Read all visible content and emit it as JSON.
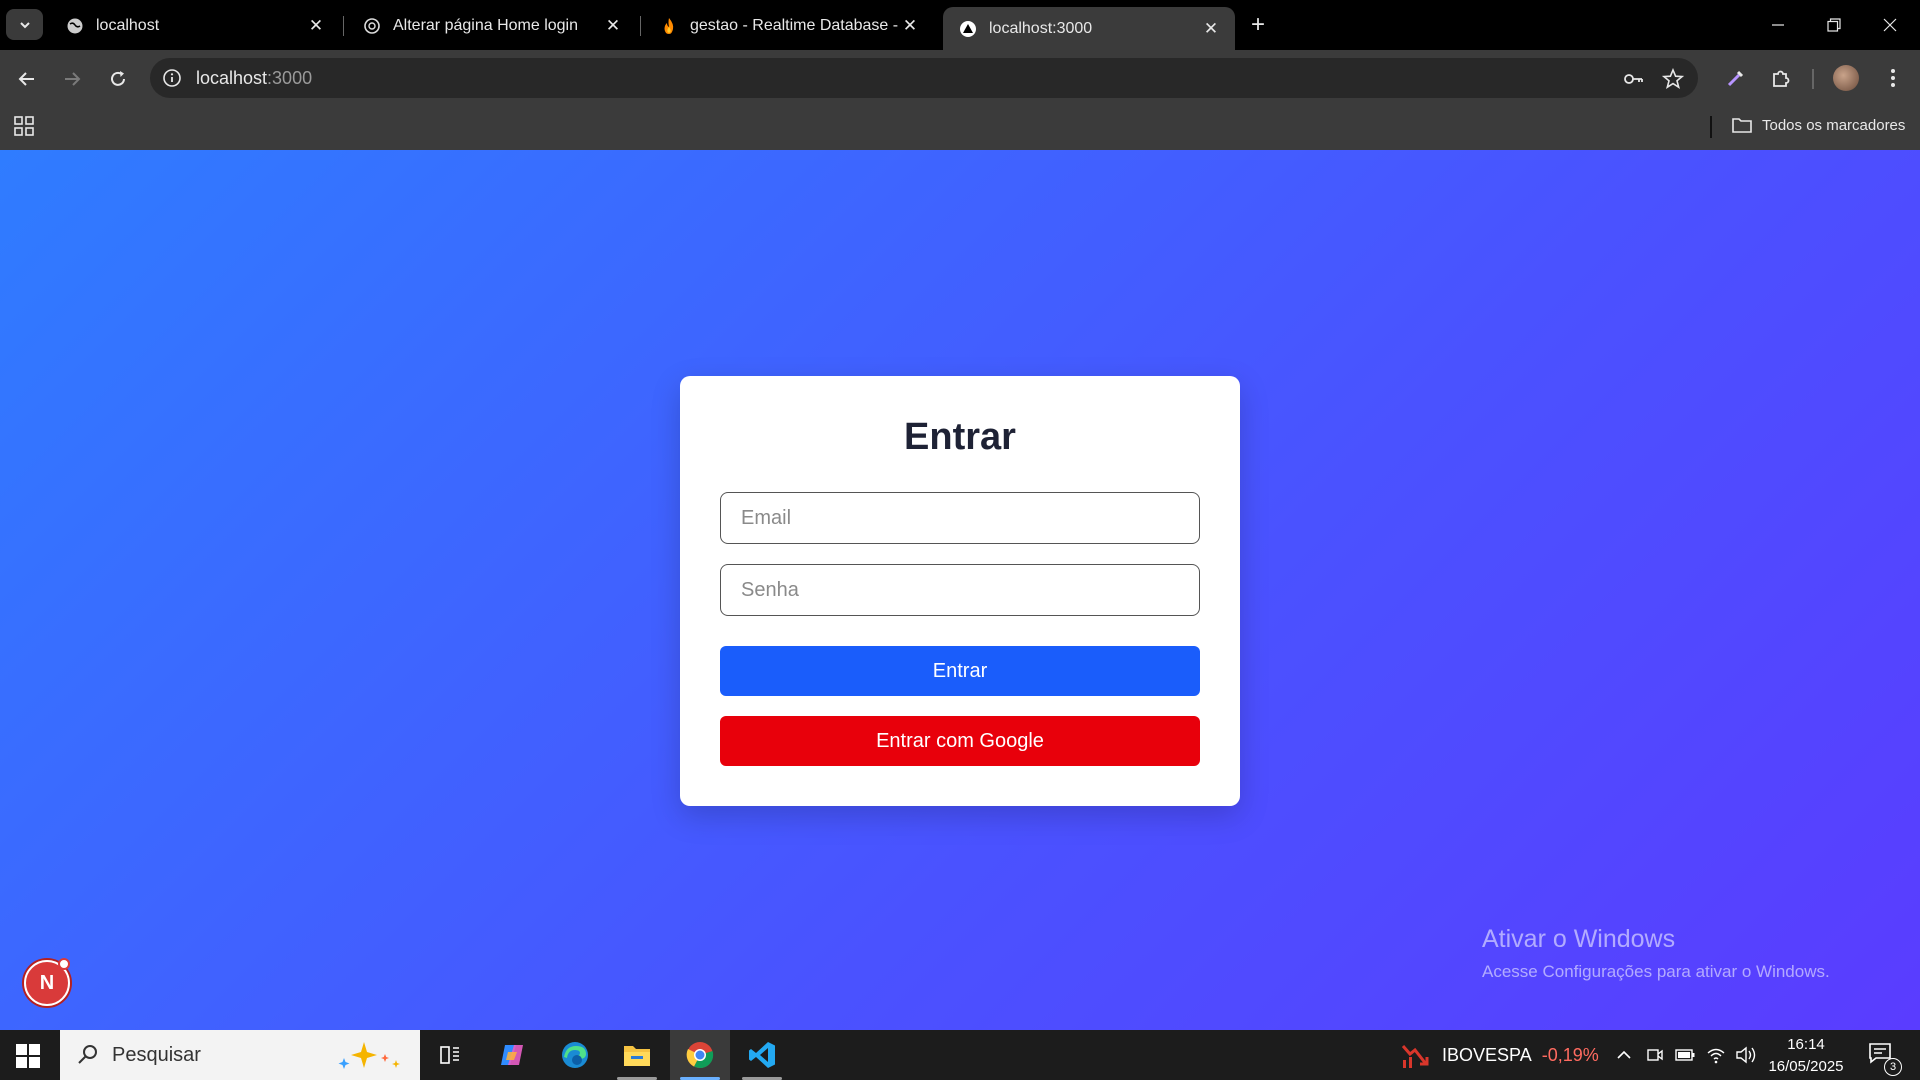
{
  "browser": {
    "tabs": [
      {
        "title": "localhost",
        "active": false
      },
      {
        "title": "Alterar página Home login",
        "active": false
      },
      {
        "title": "gestao - Realtime Database - D",
        "active": false
      },
      {
        "title": "localhost:3000",
        "active": true
      }
    ],
    "url_host": "localhost",
    "url_port": ":3000",
    "bookmarks_label": "Todos os marcadores"
  },
  "login": {
    "title": "Entrar",
    "email_placeholder": "Email",
    "password_placeholder": "Senha",
    "submit_label": "Entrar",
    "google_label": "Entrar com Google",
    "colors": {
      "primary": "#1a5dfb",
      "google": "#e8000b"
    }
  },
  "watermark": {
    "line1": "Ativar o Windows",
    "line2": "Acesse Configurações para ativar o Windows."
  },
  "dev_badge": {
    "letter": "N"
  },
  "taskbar": {
    "search_text": "Pesquisar",
    "ticker_name": "IBOVESPA",
    "ticker_change": "-0,19%",
    "time": "16:14",
    "date": "16/05/2025",
    "notification_count": "3"
  }
}
